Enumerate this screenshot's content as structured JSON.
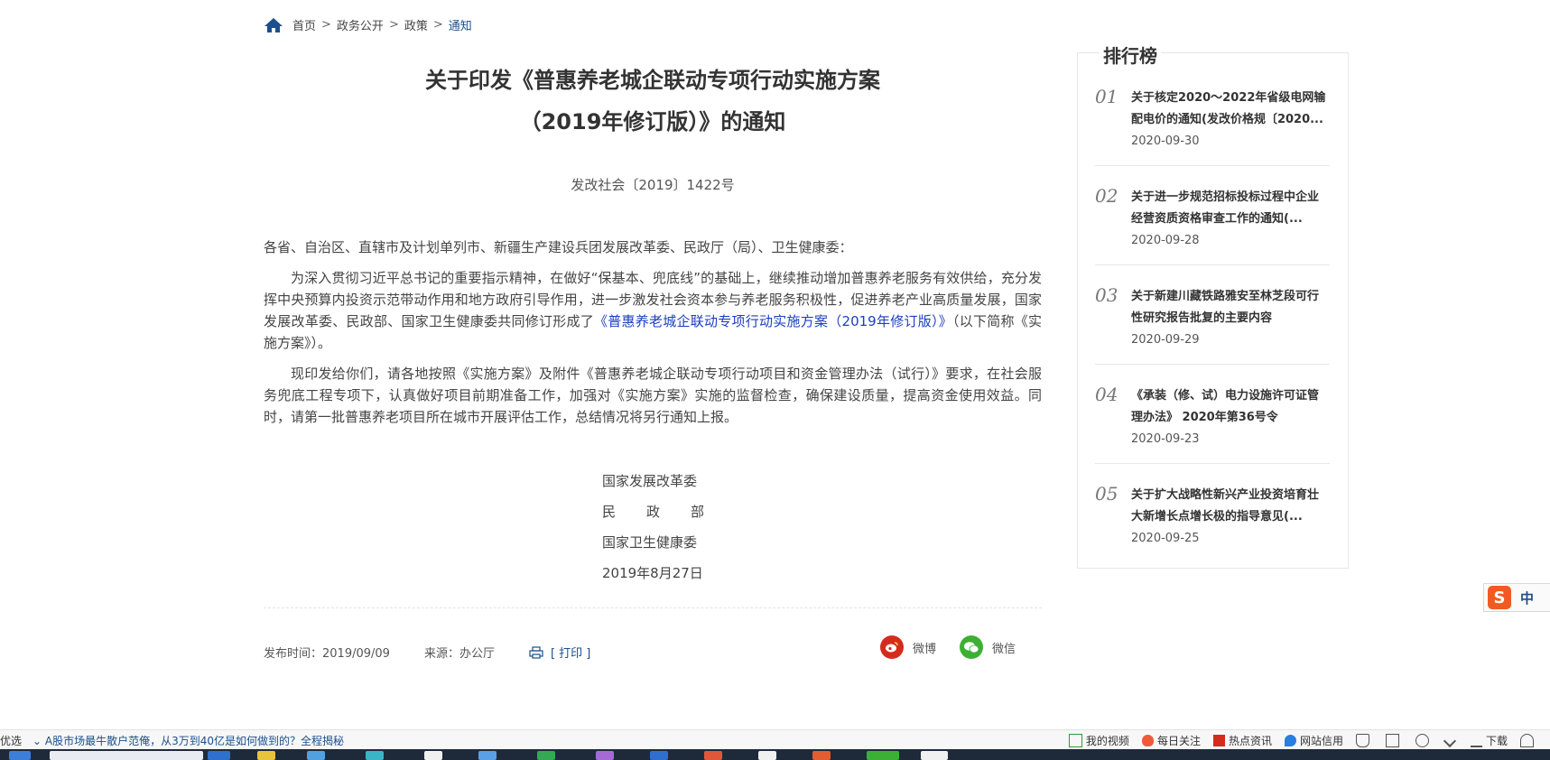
{
  "breadcrumb": {
    "items": [
      "首页",
      "政务公开",
      "政策"
    ],
    "current": "通知",
    "separator": ">"
  },
  "article": {
    "title_line1": "关于印发《普惠养老城企联动专项行动实施方案",
    "title_line2": "（2019年修订版）》的通知",
    "doc_no": "发改社会〔2019〕1422号",
    "salutation": "各省、自治区、直辖市及计划单列市、新疆生产建设兵团发展改革委、民政厅（局）、卫生健康委：",
    "para1_pre": "为深入贯彻习近平总书记的重要指示精神，在做好“保基本、兜底线”的基础上，继续推动增加普惠养老服务有效供给，充分发挥中央预算内投资示范带动作用和地方政府引导作用，进一步激发社会资本参与养老服务积极性，促进养老产业高质量发展，国家发展改革委、民政部、国家卫生健康委共同修订形成了",
    "para1_link": "《普惠养老城企联动专项行动实施方案（2019年修订版）》",
    "para1_post": "（以下简称《实施方案》）。",
    "para2": "现印发给你们，请各地按照《实施方案》及附件《普惠养老城企联动专项行动项目和资金管理办法（试行）》要求，在社会服务兜底工程专项下，认真做好项目前期准备工作，加强对《实施方案》实施的监督检查，确保建设质量，提高资金使用效益。同时，请第一批普惠养老项目所在城市开展评估工作，总结情况将另行通知上报。",
    "sign1": "国家发展改革委",
    "sign2": "民政部",
    "sign3": "国家卫生健康委",
    "sign_date": "2019年8月27日"
  },
  "meta": {
    "publish": "发布时间：2019/09/09",
    "source": "来源：办公厅",
    "print": "[ 打印 ]"
  },
  "share": {
    "weibo": "微博",
    "wechat": "微信"
  },
  "ranking": {
    "title": "排行榜",
    "items": [
      {
        "num": "01",
        "title": "关于核定2020～2022年省级电网输配电价的通知(发改价格规〔2020...",
        "date": "2020-09-30"
      },
      {
        "num": "02",
        "title": "关于进一步规范招标投标过程中企业经营资质资格审查工作的通知(...",
        "date": "2020-09-28"
      },
      {
        "num": "03",
        "title": "关于新建川藏铁路雅安至林芝段可行性研究报告批复的主要内容",
        "date": "2020-09-29"
      },
      {
        "num": "04",
        "title": "《承装（修、试）电力设施许可证管理办法》 2020年第36号令",
        "date": "2020-09-23"
      },
      {
        "num": "05",
        "title": "关于扩大战略性新兴产业投资培育壮大新增长点增长极的指导意见(...",
        "date": "2020-09-25"
      }
    ]
  },
  "ime": {
    "logo": "S",
    "mode": "中"
  },
  "statusbar": {
    "left_label": "优选",
    "news": "A股市场最牛散户范俺，从3万到40亿是如何做到的？全程揭秘",
    "items": [
      "我的视频",
      "每日关注",
      "热点资讯",
      "网站信用",
      "下载"
    ]
  },
  "colors": {
    "link": "#1a3fbf",
    "accent": "#1b4f8c",
    "weibo": "#d52b1e",
    "wechat": "#3cb034"
  }
}
